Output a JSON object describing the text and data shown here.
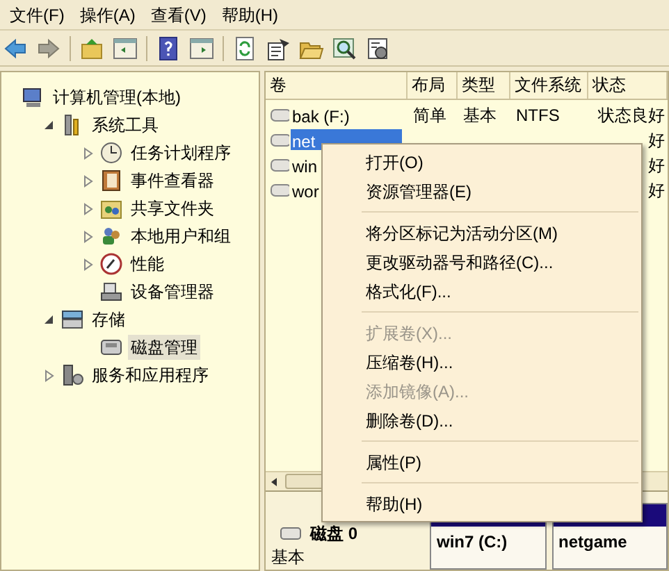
{
  "menubar": [
    "文件(F)",
    "操作(A)",
    "查看(V)",
    "帮助(H)"
  ],
  "tree": [
    {
      "label": "计算机管理(本地)",
      "children": [
        {
          "label": "系统工具",
          "expanded": true,
          "children": [
            {
              "label": "任务计划程序",
              "expanded": false
            },
            {
              "label": "事件查看器",
              "expanded": false
            },
            {
              "label": "共享文件夹",
              "expanded": false
            },
            {
              "label": "本地用户和组",
              "expanded": false
            },
            {
              "label": "性能",
              "expanded": false
            },
            {
              "label": "设备管理器"
            }
          ]
        },
        {
          "label": "存储",
          "expanded": true,
          "children": [
            {
              "label": "磁盘管理",
              "selected": true
            }
          ]
        },
        {
          "label": "服务和应用程序",
          "expanded": false
        }
      ]
    }
  ],
  "table": {
    "columns": [
      "卷",
      "布局",
      "类型",
      "文件系统",
      "状态"
    ],
    "rows": [
      {
        "selected": false,
        "cells": [
          "bak (F:)",
          "简单",
          "基本",
          "NTFS",
          "状态良好"
        ]
      },
      {
        "selected": true,
        "cells": [
          "net",
          "",
          "",
          "",
          "好"
        ]
      },
      {
        "selected": false,
        "cells": [
          "win",
          "",
          "",
          "",
          "好"
        ]
      },
      {
        "selected": false,
        "cells": [
          "wor",
          "",
          "",
          "",
          "好"
        ]
      }
    ]
  },
  "disk": {
    "name": "磁盘 0",
    "type": "基本",
    "partitions": [
      "win7  (C:)",
      "netgame"
    ]
  },
  "context_menu": [
    {
      "kind": "item",
      "label": "打开(O)",
      "disabled": false
    },
    {
      "kind": "item",
      "label": "资源管理器(E)",
      "disabled": false
    },
    {
      "kind": "separator"
    },
    {
      "kind": "item",
      "label": "将分区标记为活动分区(M)",
      "disabled": false
    },
    {
      "kind": "item",
      "label": "更改驱动器号和路径(C)...",
      "disabled": false
    },
    {
      "kind": "item",
      "label": "格式化(F)...",
      "disabled": false
    },
    {
      "kind": "separator"
    },
    {
      "kind": "item",
      "label": "扩展卷(X)...",
      "disabled": true
    },
    {
      "kind": "item",
      "label": "压缩卷(H)...",
      "disabled": false
    },
    {
      "kind": "item",
      "label": "添加镜像(A)...",
      "disabled": true
    },
    {
      "kind": "item",
      "label": "删除卷(D)...",
      "disabled": false
    },
    {
      "kind": "separator"
    },
    {
      "kind": "item",
      "label": "属性(P)",
      "disabled": false
    },
    {
      "kind": "separator"
    },
    {
      "kind": "item",
      "label": "帮助(H)",
      "disabled": false
    }
  ]
}
